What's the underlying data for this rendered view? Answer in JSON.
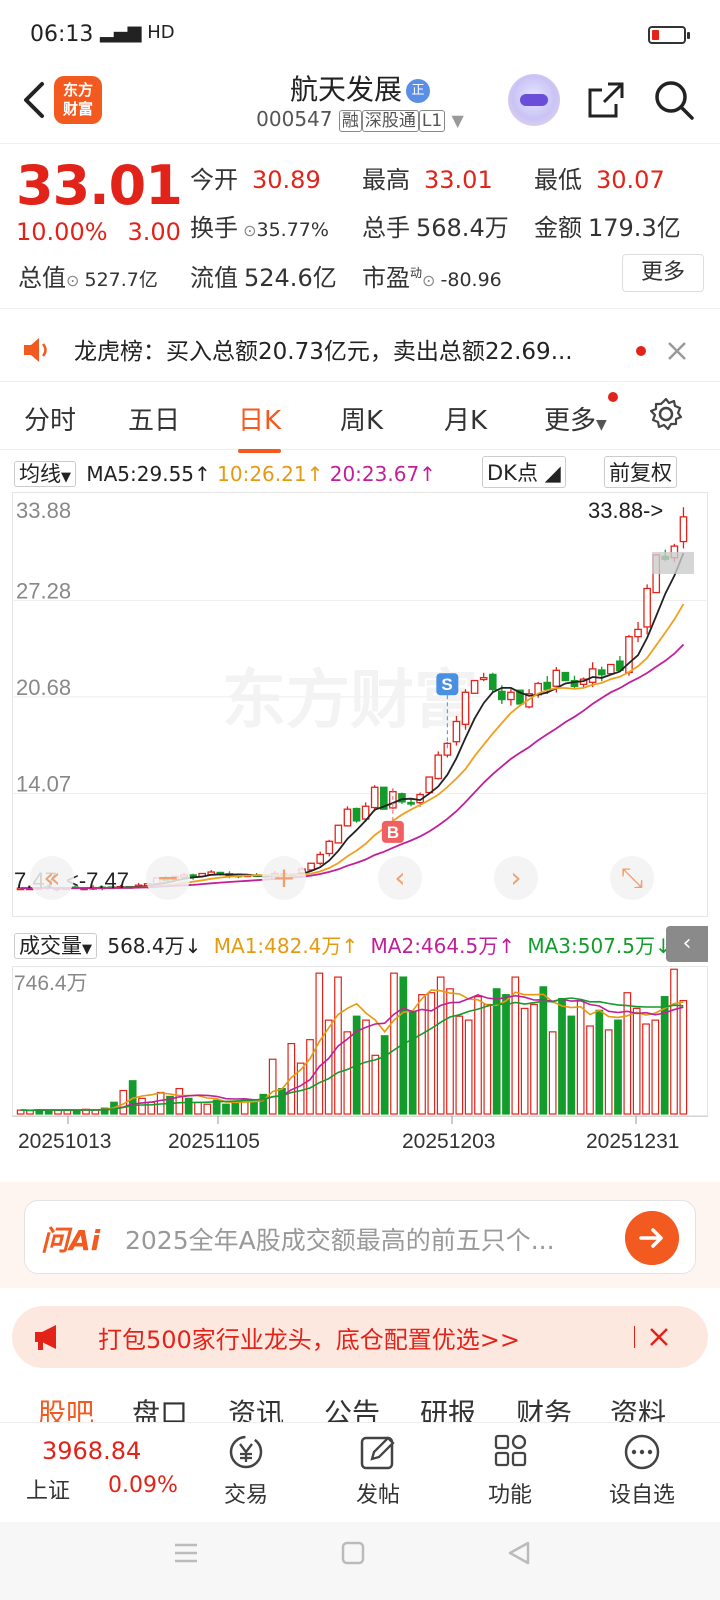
{
  "status": {
    "time": "06:13",
    "signal": "4G",
    "network": "HD"
  },
  "header": {
    "logo_line1": "东方",
    "logo_line2": "财富",
    "title": "航天发展",
    "title_badge": "正",
    "code": "000547",
    "tags": [
      "融",
      "深股通",
      "L1"
    ]
  },
  "quote": {
    "price": "33.01",
    "change_pct": "10.00%",
    "change_amt": "3.00",
    "open_label": "今开",
    "open": "30.89",
    "high_label": "最高",
    "high": "33.01",
    "low_label": "最低",
    "low": "30.07",
    "turnover_label": "换手",
    "turnover": "35.77%",
    "vol_label": "总手",
    "vol": "568.4万",
    "amount_label": "金额",
    "amount": "179.3亿",
    "mktcap_label": "总值",
    "mktcap": "527.7亿",
    "float_label": "流值",
    "float": "524.6亿",
    "pe_label": "市盈",
    "pe_sup": "动",
    "pe": "-80.96",
    "more": "更多"
  },
  "notice": {
    "text": "龙虎榜：买入总额20.73亿元，卖出总额22.69..."
  },
  "tabs": [
    {
      "label": "分时"
    },
    {
      "label": "五日"
    },
    {
      "label": "日K"
    },
    {
      "label": "周K"
    },
    {
      "label": "月K"
    },
    {
      "label": "更多"
    }
  ],
  "ma": {
    "selector": "均线",
    "ma5": "MA5:29.55",
    "ma10": "10:26.21",
    "ma20": "20:23.67",
    "dk": "DK点",
    "adjust": "前复权"
  },
  "chart_data": {
    "type": "candlestick",
    "ylim": [
      7.47,
      33.88
    ],
    "y_ticks": [
      "33.88",
      "27.28",
      "20.68",
      "14.07",
      "7.47"
    ],
    "max_label": "33.88->",
    "min_label": "<-7.47",
    "sell_marker": "S",
    "buy_marker": "B",
    "x_labels": [
      "20251013",
      "20251105",
      "20251203",
      "20251231"
    ],
    "watermark": "东方财富",
    "colors": {
      "up": "#e2231a",
      "down": "#139b2c",
      "ma5": "#222222",
      "ma10": "#f0a020",
      "ma20": "#c0209a"
    },
    "closes": [
      7.6,
      7.6,
      7.62,
      7.58,
      7.6,
      7.62,
      7.6,
      7.6,
      7.64,
      7.6,
      7.65,
      7.7,
      7.68,
      7.8,
      7.9,
      8.3,
      8.1,
      8.4,
      8.5,
      8.35,
      8.6,
      8.7,
      8.55,
      8.4,
      8.45,
      8.5,
      8.4,
      8.35,
      8.6,
      8.5,
      8.55,
      8.9,
      9.3,
      9.9,
      10.8,
      11.9,
      13.0,
      12.2,
      13.2,
      14.5,
      13.0,
      14.2,
      13.5,
      13.4,
      14.0,
      15.2,
      16.7,
      17.5,
      19.0,
      21.0,
      21.8,
      22.0,
      21.2,
      20.5,
      21.0,
      20.2,
      20.9,
      21.6,
      21.2,
      22.5,
      21.8,
      21.4,
      21.9,
      22.6,
      22.2,
      22.9,
      22.5,
      24.8,
      25.3,
      28.1,
      30.4,
      30.1,
      31.0,
      33.0
    ],
    "volume": {
      "ylim": [
        0,
        746.4
      ],
      "y_tick": "746.4万",
      "label": "成交量",
      "last": "568.4万",
      "ma1": "MA1:482.4万",
      "ma2": "MA2:464.5万",
      "ma3": "MA3:507.5万",
      "values": [
        20,
        18,
        22,
        20,
        19,
        21,
        20,
        24,
        22,
        30,
        60,
        120,
        170,
        80,
        60,
        110,
        90,
        130,
        80,
        60,
        50,
        70,
        50,
        65,
        70,
        60,
        100,
        280,
        130,
        360,
        260,
        380,
        720,
        480,
        700,
        420,
        500,
        480,
        300,
        400,
        720,
        700,
        520,
        610,
        620,
        700,
        640,
        500,
        480,
        600,
        560,
        640,
        610,
        700,
        540,
        560,
        650,
        420,
        590,
        500,
        580,
        450,
        530,
        430,
        480,
        620,
        540,
        460,
        480,
        600,
        740,
        580
      ]
    }
  },
  "ai": {
    "logo": "问Ai",
    "placeholder": "2025全年A股成交额最高的前五只个..."
  },
  "ad": {
    "text": "打包500家行业龙头，底仓配置优选>>"
  },
  "subtabs": [
    "股吧",
    "盘口",
    "资讯",
    "公告",
    "研报",
    "财务",
    "资料"
  ],
  "bottom": {
    "index_value": "3968.84",
    "index_name": "上证",
    "index_pct": "0.09%",
    "trade": "交易",
    "post": "发帖",
    "func": "功能",
    "watch": "设自选"
  }
}
